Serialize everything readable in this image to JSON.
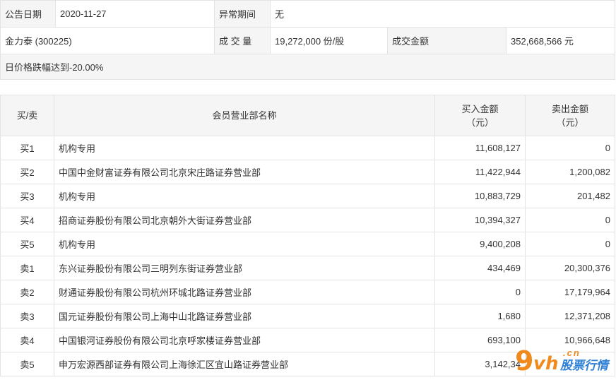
{
  "info": {
    "date_label": "公告日期",
    "date_value": "2020-11-27",
    "period_label": "异常期间",
    "period_value": "无",
    "stock_name": "金力泰 (300225)",
    "volume_label": "成 交 量",
    "volume_value": "19,272,000 份/股",
    "amount_label": "成交金额",
    "amount_value": "352,668,566 元",
    "reason": "日价格跌幅达到-20.00%"
  },
  "table": {
    "headers": {
      "side": "买/卖",
      "dept": "会员营业部名称",
      "buy_line1": "买入金额",
      "buy_line2": "（元）",
      "sell_line1": "卖出金额",
      "sell_line2": "（元）"
    },
    "rows": [
      {
        "side": "买1",
        "name": "机构专用",
        "buy": "11,608,127",
        "sell": "0"
      },
      {
        "side": "买2",
        "name": "中国中金财富证券有限公司北京宋庄路证券营业部",
        "buy": "11,422,944",
        "sell": "1,200,082"
      },
      {
        "side": "买3",
        "name": "机构专用",
        "buy": "10,883,729",
        "sell": "201,482"
      },
      {
        "side": "买4",
        "name": "招商证券股份有限公司北京朝外大街证券营业部",
        "buy": "10,394,327",
        "sell": "0"
      },
      {
        "side": "买5",
        "name": "机构专用",
        "buy": "9,400,208",
        "sell": "0"
      },
      {
        "side": "卖1",
        "name": "东兴证券股份有限公司三明列东街证券营业部",
        "buy": "434,469",
        "sell": "20,300,376"
      },
      {
        "side": "卖2",
        "name": "财通证券股份有限公司杭州环城北路证券营业部",
        "buy": "0",
        "sell": "17,179,964"
      },
      {
        "side": "卖3",
        "name": "国元证券股份有限公司上海中山北路证券营业部",
        "buy": "1,680",
        "sell": "12,371,208"
      },
      {
        "side": "卖4",
        "name": "中国银河证券股份有限公司北京呼家楼证券营业部",
        "buy": "693,100",
        "sell": "10,966,648"
      },
      {
        "side": "卖5",
        "name": "申万宏源西部证券有限公司上海徐汇区宜山路证券营业部",
        "buy": "3,142,34",
        "sell": ""
      }
    ]
  },
  "watermark": {
    "logo_nine": "9",
    "logo_vh": "vh",
    "logo_cn": ".cn",
    "logo_text": "股票行情"
  }
}
